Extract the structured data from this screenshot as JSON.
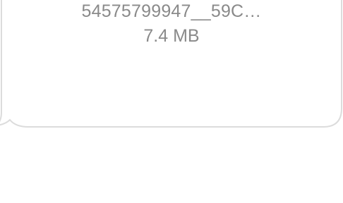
{
  "attachment": {
    "file_name": "54575799947__59C…",
    "file_size": "7.4 MB"
  },
  "colors": {
    "bubble_fill": "#ffffff",
    "bubble_border": "#dcdcdc",
    "text": "#8a8a8a"
  }
}
